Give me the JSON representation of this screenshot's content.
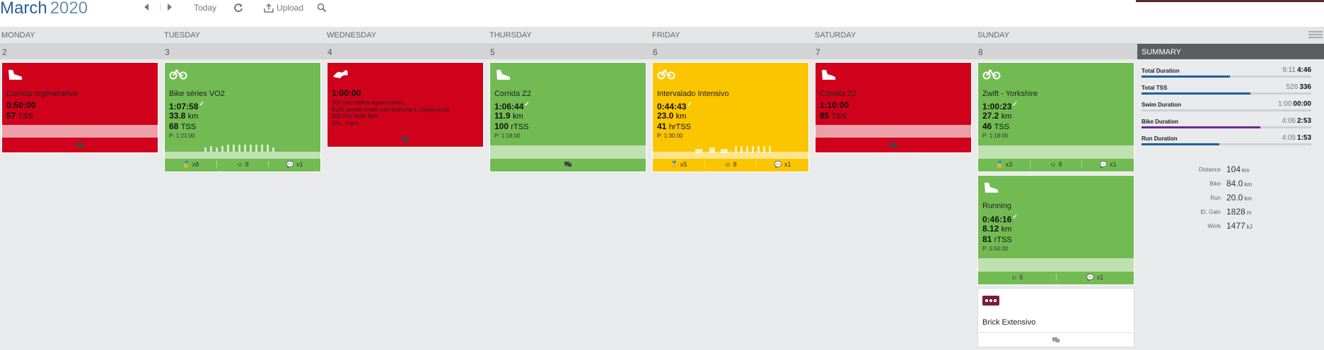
{
  "header": {
    "month": "March",
    "year": "2020",
    "today_label": "Today",
    "upload_label": "Upload"
  },
  "days": [
    "MONDAY",
    "TUESDAY",
    "WEDNESDAY",
    "THURSDAY",
    "FRIDAY",
    "SATURDAY",
    "SUNDAY"
  ],
  "dates": [
    "2",
    "3",
    "4",
    "5",
    "6",
    "7",
    "8"
  ],
  "workouts": {
    "mon": {
      "title": "Corrida regenerativa",
      "duration": "0:50:00",
      "tss": "57",
      "tss_unit": "TSS",
      "color": "#d0021b",
      "icon": "run-shoe-icon"
    },
    "tue": {
      "title": "Bike séries VO2",
      "duration": "1:07:58",
      "distance": "33.8",
      "distance_unit": "km",
      "tss": "68",
      "tss_unit": "TSS",
      "planned": "P: 1:21:00",
      "footer": [
        "x8",
        "8",
        "x1"
      ],
      "color": "#72bb53",
      "icon": "bike-icon"
    },
    "wed": {
      "title": "1:00:00",
      "desc": "300 mts estilos aquecimento\n8x25 pernas crawl com prancha e 15seg recup\n200 mts nado fácil\n10x...more...",
      "color": "#d0021b",
      "icon": "swim-icon"
    },
    "thu": {
      "title": "Corrida Z2",
      "duration": "1:06:44",
      "distance": "11.9",
      "distance_unit": "km",
      "tss": "100",
      "tss_unit": "rTSS",
      "planned": "P: 1:18:00",
      "color": "#72bb53",
      "icon": "run-shoe-icon"
    },
    "fri": {
      "title": "Intervalado Intensivo",
      "duration": "0:44:43",
      "distance": "23.0",
      "distance_unit": "km",
      "tss": "41",
      "tss_unit": "hrTSS",
      "planned": "P: 1:30:00",
      "footer": [
        "x5",
        "8",
        "x1"
      ],
      "color": "#fbc500",
      "icon": "bike-icon"
    },
    "sat": {
      "title": "Corrida Z2",
      "duration": "1:10:00",
      "tss": "85",
      "tss_unit": "TSS",
      "color": "#d0021b",
      "icon": "run-shoe-icon"
    },
    "sun1": {
      "title": "Zwift - Yorkshire",
      "duration": "1:00:23",
      "distance": "27.2",
      "distance_unit": "km",
      "tss": "46",
      "tss_unit": "TSS",
      "planned": "P: 1:18:00",
      "footer": [
        "x3",
        "8",
        "x1"
      ],
      "color": "#72bb53",
      "icon": "bike-icon"
    },
    "sun2": {
      "title": "Running",
      "duration": "0:46:16",
      "distance": "8.12",
      "distance_unit": "km",
      "tss": "81",
      "tss_unit": "rTSS",
      "planned": "P: 0:50:00",
      "footer": [
        "5",
        "x1"
      ],
      "color": "#72bb53",
      "icon": "run-shoe-icon"
    },
    "sun3": {
      "title": "Brick Extensivo",
      "color": "#ffffff",
      "icon": "brick-icon"
    }
  },
  "summary": {
    "title": "SUMMARY",
    "rows": [
      {
        "label": "Total Duration",
        "planned": "9:11",
        "actual": "4:46",
        "fill": 0.52,
        "color": "#1f5fa0"
      },
      {
        "label": "Total TSS",
        "planned": "526",
        "actual": "336",
        "fill": 0.64,
        "color": "#1f5fa0"
      },
      {
        "label": "Swim Duration",
        "planned": "1:00",
        "actual": "00:00",
        "fill": 0.0,
        "color": "#1f5fa0"
      },
      {
        "label": "Bike Duration",
        "planned": "4:06",
        "actual": "2:53",
        "fill": 0.7,
        "color": "#6a2a8a"
      },
      {
        "label": "Run Duration",
        "planned": "4:05",
        "actual": "1:53",
        "fill": 0.46,
        "color": "#1f5fa0"
      }
    ],
    "stats": [
      {
        "label": "Distance",
        "value": "104",
        "unit": "km"
      },
      {
        "label": "Bike",
        "value": "84.0",
        "unit": "km"
      },
      {
        "label": "Run",
        "value": "20.0",
        "unit": "km"
      },
      {
        "label": "El. Gain",
        "value": "1828",
        "unit": "m"
      },
      {
        "label": "Work",
        "value": "1477",
        "unit": "kJ"
      }
    ]
  }
}
